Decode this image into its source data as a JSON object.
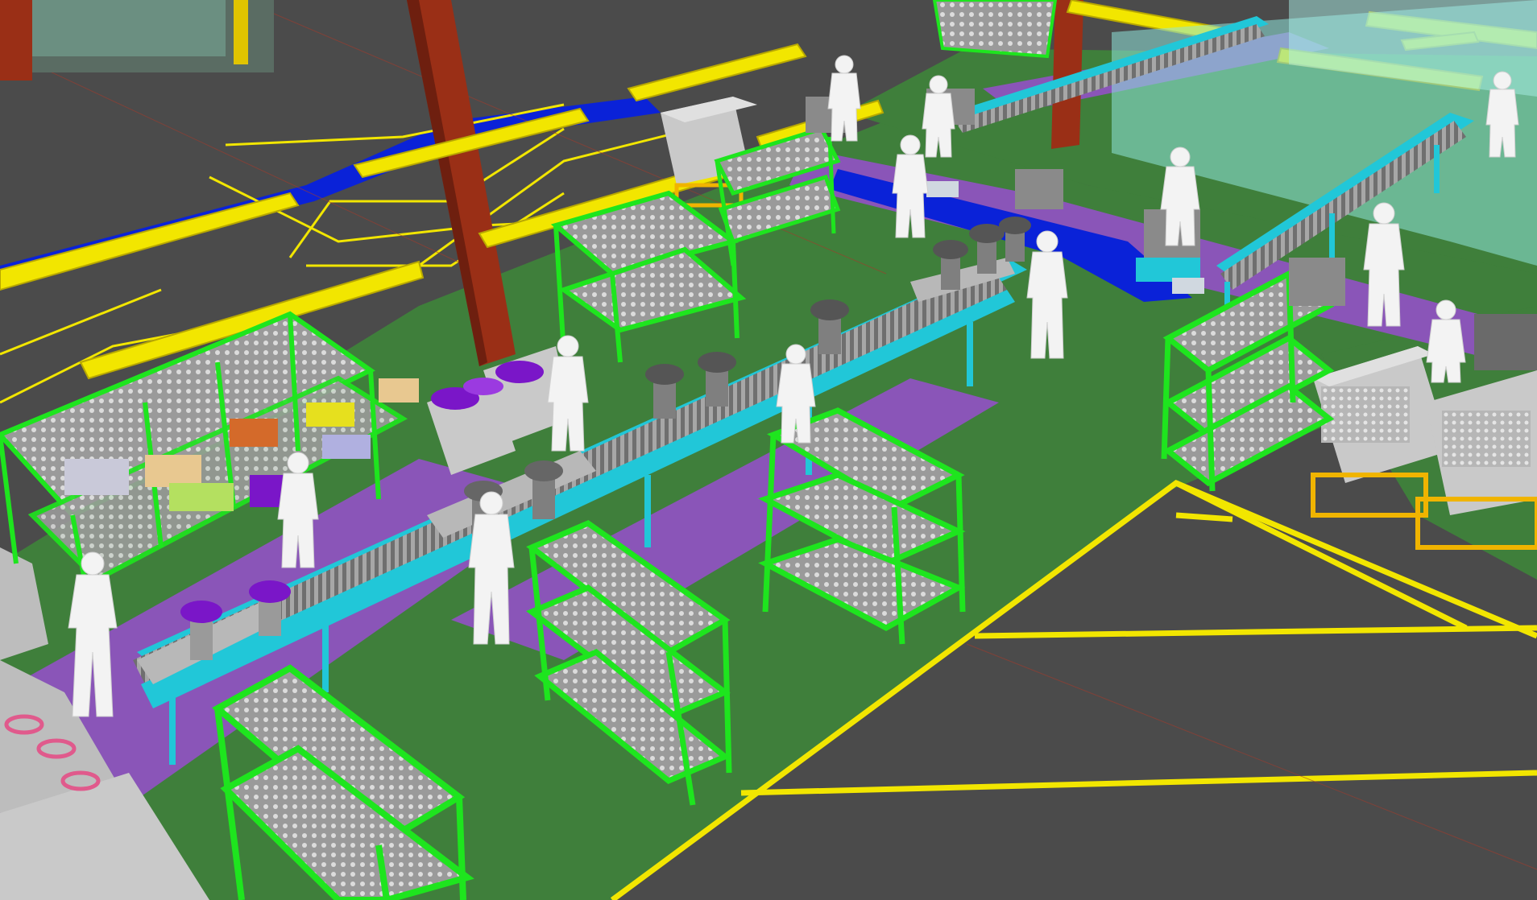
{
  "scene": {
    "kind": "3d-factory-layout-render",
    "text_labels": []
  },
  "palette": {
    "floor": "#4b4b4b",
    "work_area": "#3f7f3b",
    "walkway": "#8a55b8",
    "aisle_line": "#f2e600",
    "column": "#9a2f16",
    "rack": "#1ee51e",
    "conveyor_frame": "#21c7d8",
    "roller": "#8a8a8a",
    "bin": "#c9c9c9",
    "part_purple": "#7a16c8",
    "pallet": "#f0b400",
    "blue_marking": "#0a22d8",
    "glass_cell": "#8fe6dd",
    "worker": "#f3f3f3"
  },
  "objects": {
    "column_count": 2,
    "rack_count": 11,
    "worker_count": 13,
    "conveyor_count": 3
  }
}
